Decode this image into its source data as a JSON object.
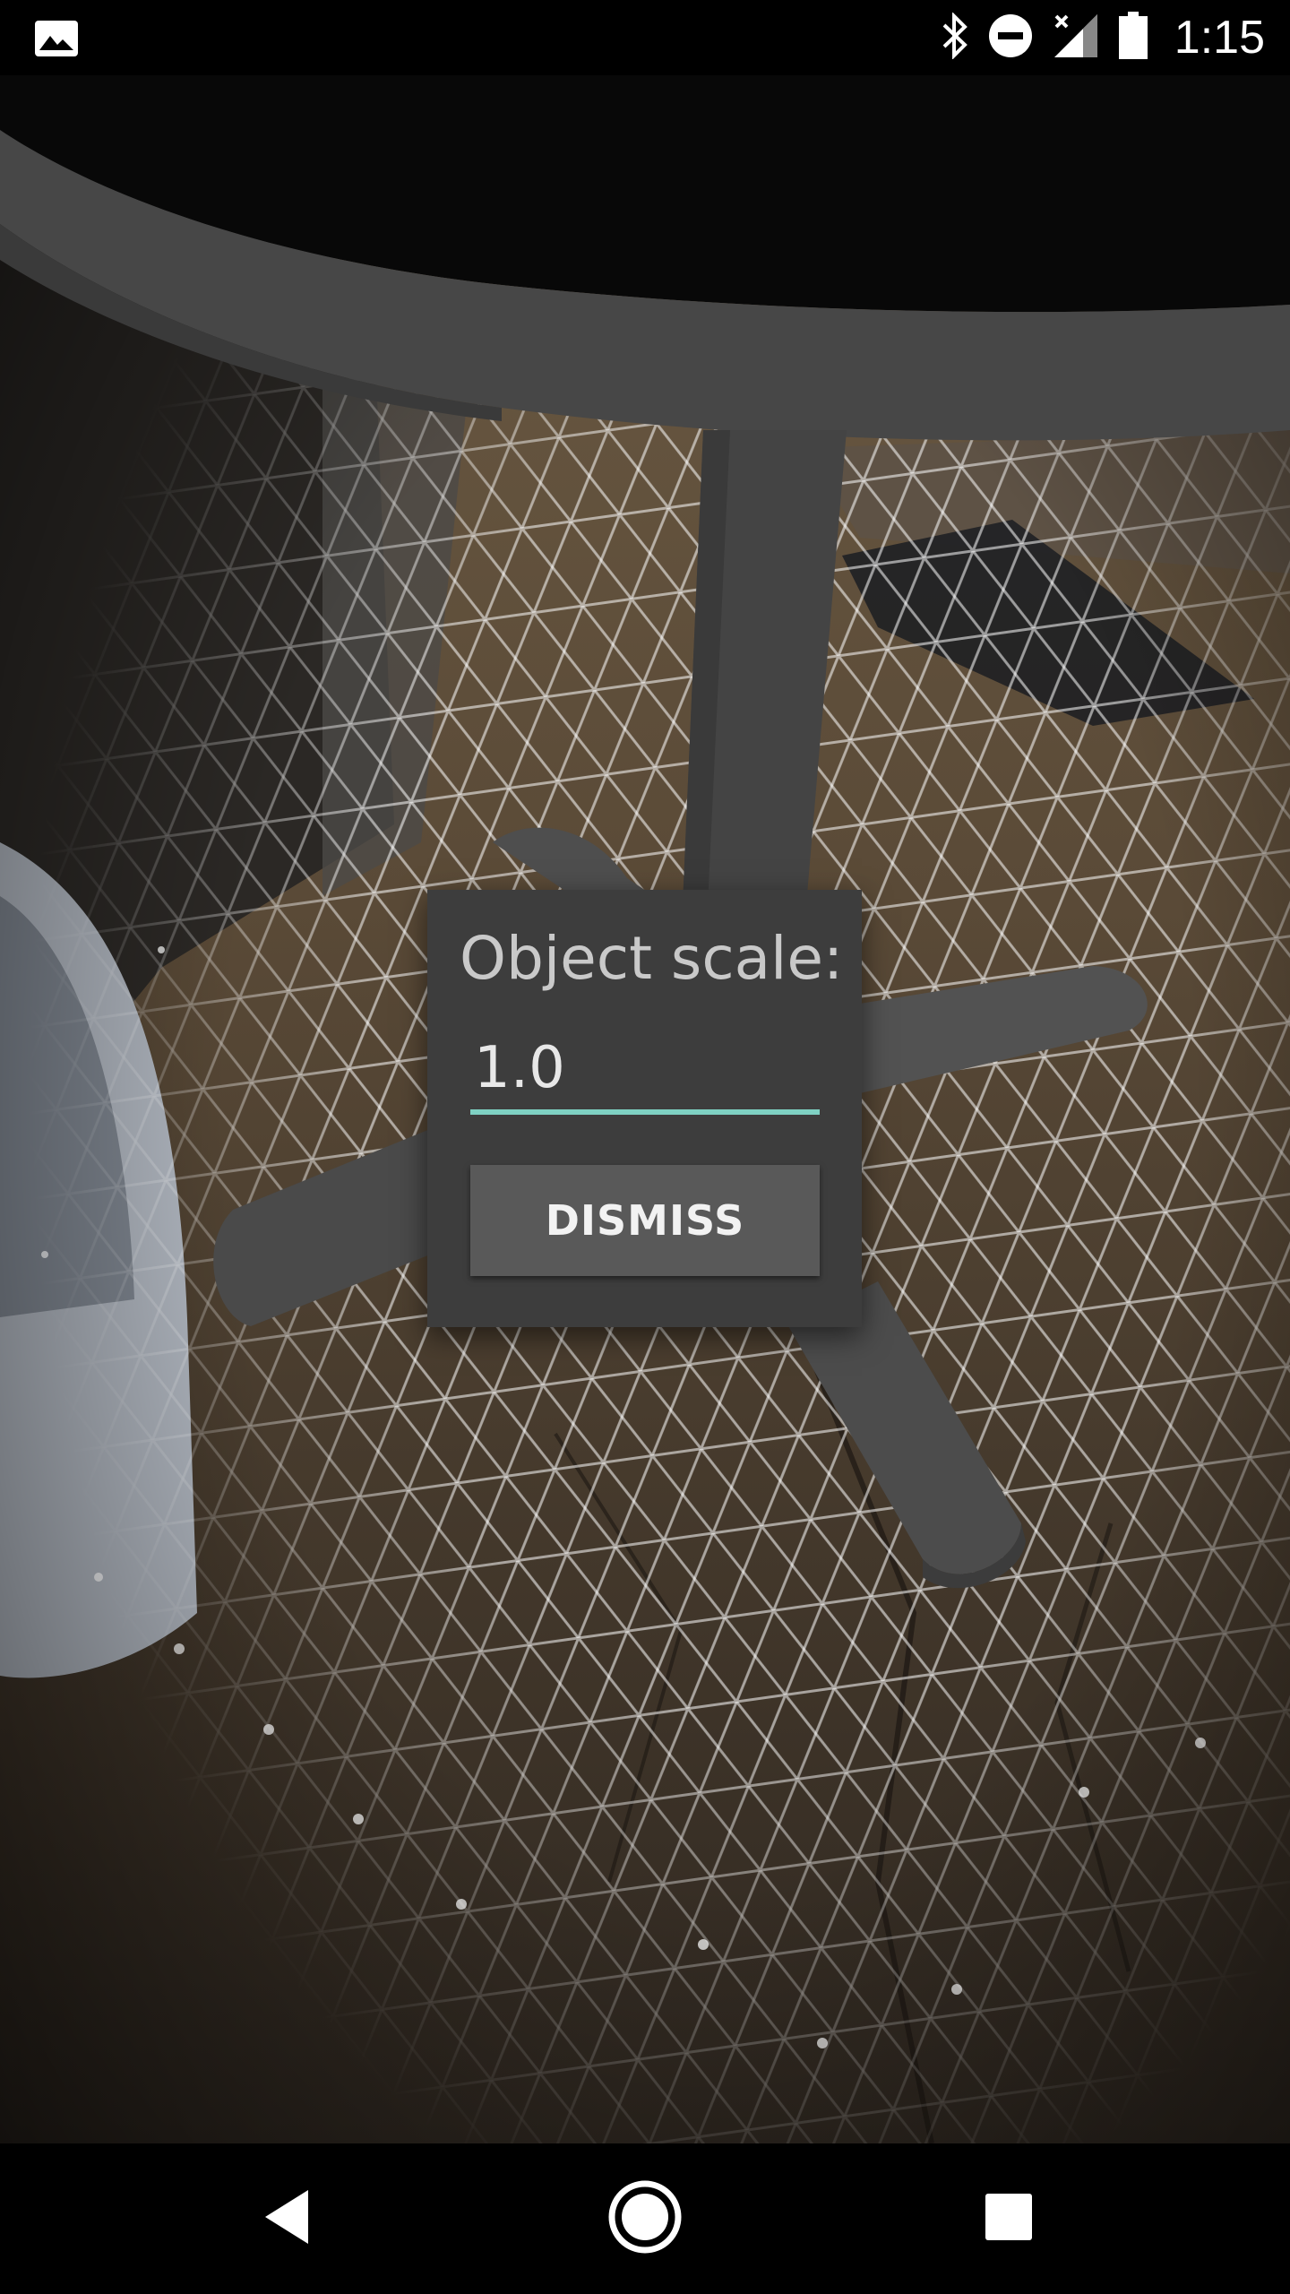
{
  "status_bar": {
    "time": "1:15",
    "icons": [
      "image-icon",
      "bluetooth-icon",
      "do-not-disturb-icon",
      "signal-icon",
      "battery-icon"
    ]
  },
  "dialog": {
    "title": "Object scale:",
    "scale_value": "1.0",
    "dismiss_label": "DISMISS"
  },
  "nav_bar": {
    "buttons": [
      "back-button",
      "home-button",
      "recents-button"
    ]
  },
  "colors": {
    "accent": "#7fd1c3",
    "dialog_bg": "#3d3d3d",
    "button_bg": "#595959"
  }
}
